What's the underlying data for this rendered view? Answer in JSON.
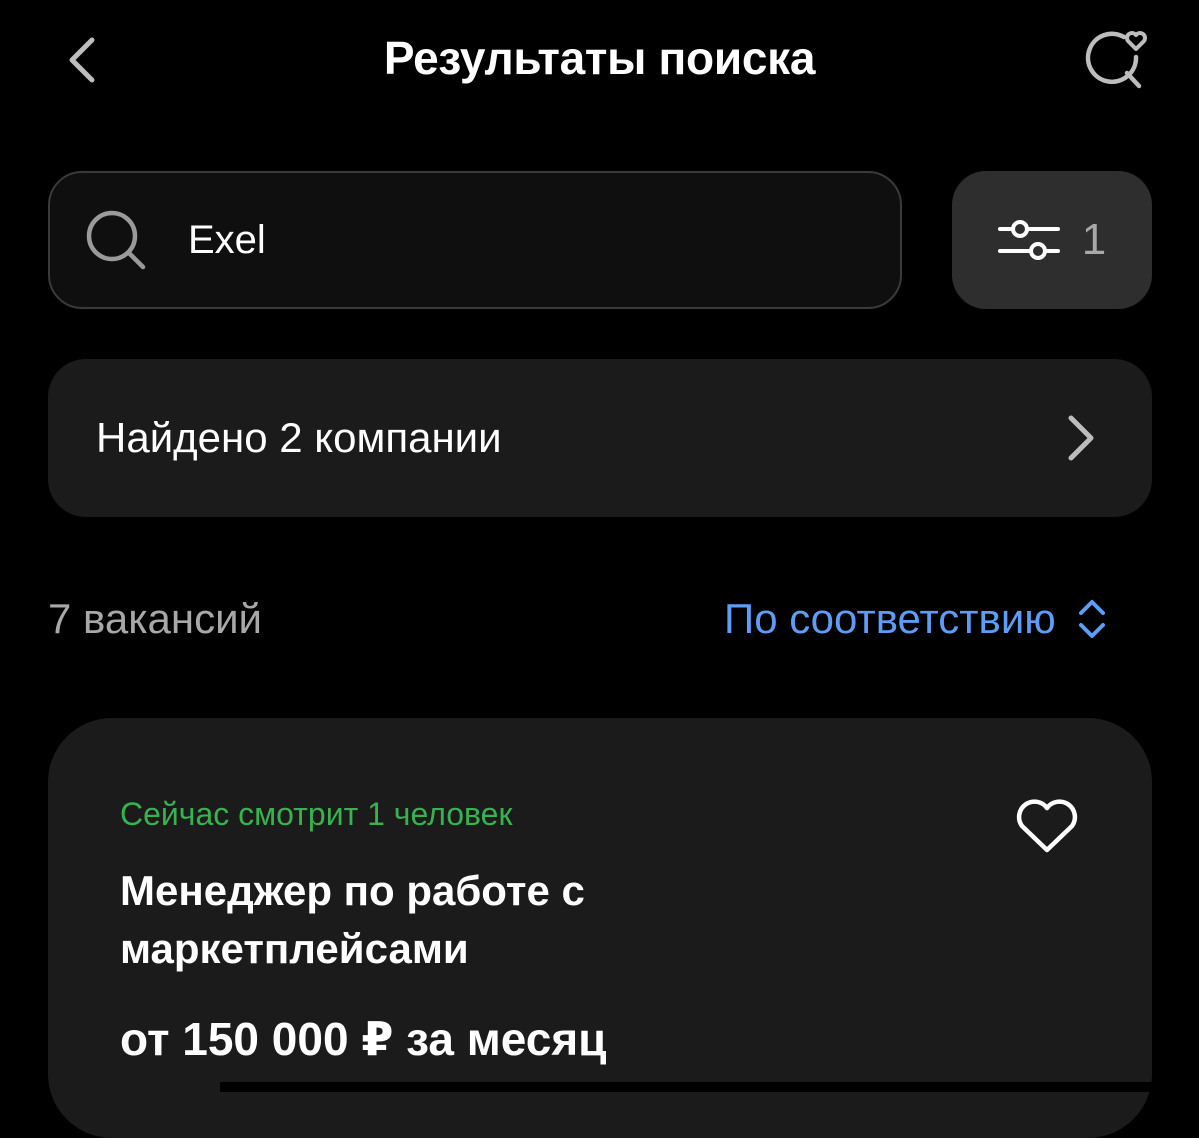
{
  "header": {
    "title": "Результаты поиска",
    "back_icon": "chevron-left-icon",
    "saved_search_icon": "search-heart-icon"
  },
  "search": {
    "value": "Exel",
    "icon": "search-icon"
  },
  "filter": {
    "icon": "sliders-icon",
    "count": "1"
  },
  "companies": {
    "label": "Найдено 2 компании",
    "icon": "chevron-right-icon"
  },
  "results": {
    "count_label": "7 вакансий",
    "sort_label": "По соответствию",
    "sort_icon": "sort-updown-icon"
  },
  "vacancy": {
    "viewers": "Сейчас смотрит 1 человек",
    "title": "Менеджер по работе с маркетплейсами",
    "salary": "от 150 000 ₽ за месяц",
    "favorite_icon": "heart-icon"
  },
  "colors": {
    "background": "#000000",
    "card": "#1b1b1b",
    "accent_blue": "#5e9df5",
    "accent_green": "#36b34f",
    "muted_text": "#a8a8a8"
  }
}
